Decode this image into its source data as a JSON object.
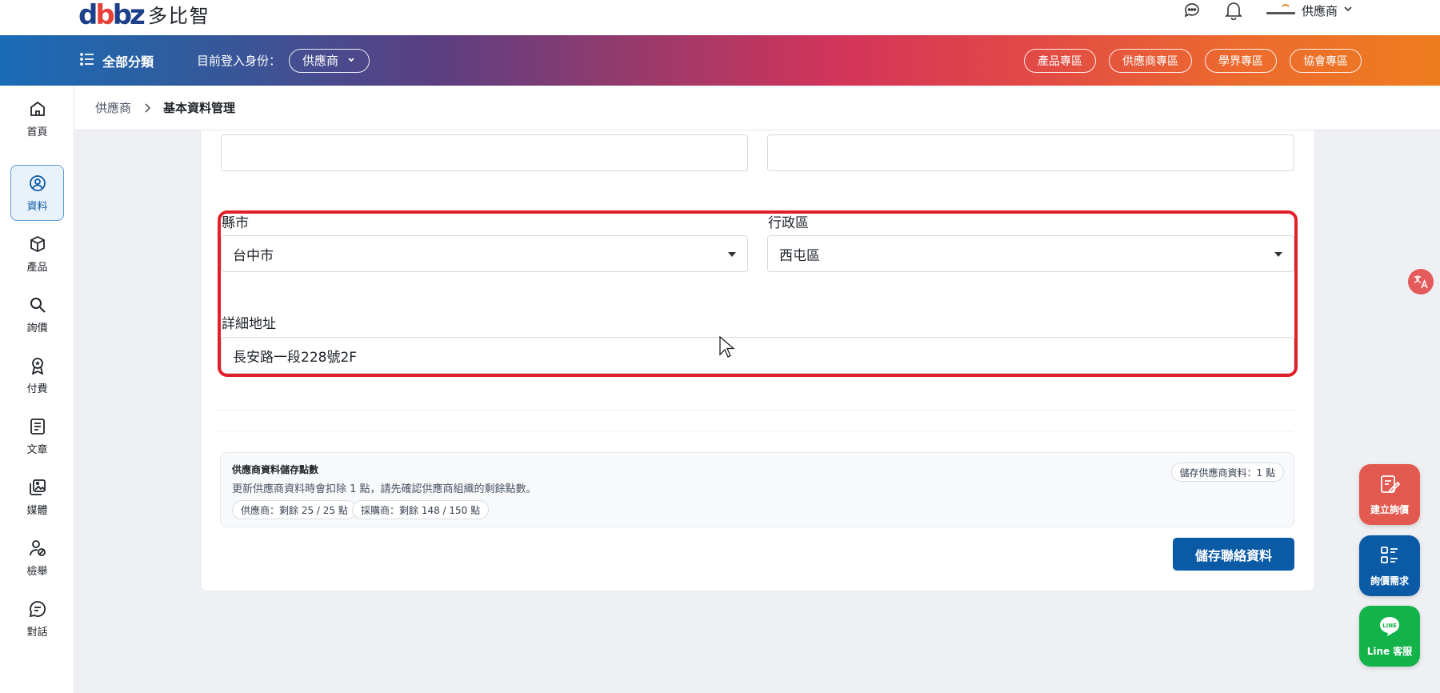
{
  "brand": {
    "name": "多比智",
    "mark": "dbbz"
  },
  "header": {
    "username": "供應商"
  },
  "nav": {
    "all_categories": "全部分類",
    "identity_label": "目前登入身份：",
    "identity_value": "供應商",
    "zones": [
      "產品專區",
      "供應商專區",
      "學界專區",
      "協會專區"
    ]
  },
  "sidebar": {
    "items": [
      {
        "label": "首頁",
        "icon": "home-icon"
      },
      {
        "label": "資料",
        "icon": "user-circle-icon"
      },
      {
        "label": "產品",
        "icon": "box-icon"
      },
      {
        "label": "詢價",
        "icon": "search-icon"
      },
      {
        "label": "付費",
        "icon": "award-icon"
      },
      {
        "label": "文章",
        "icon": "document-icon"
      },
      {
        "label": "媒體",
        "icon": "gallery-icon"
      },
      {
        "label": "檢舉",
        "icon": "user-ban-icon"
      },
      {
        "label": "對話",
        "icon": "chat-icon"
      }
    ],
    "active_index": 1
  },
  "breadcrumb": {
    "parent": "供應商",
    "current": "基本資料管理"
  },
  "form": {
    "city_label": "縣市",
    "city_value": "台中市",
    "district_label": "行政區",
    "district_value": "西屯區",
    "address_label": "詳細地址",
    "address_value": "長安路一段228號2F"
  },
  "points": {
    "title": "供應商資料儲存點數",
    "description": "更新供應商資料時會扣除 1 點，請先確認供應商組織的剩餘點數。",
    "cost_badge": "儲存供應商資料：1 點",
    "supplier_pill": "供應商：剩餘 25 / 25 點",
    "buyer_pill": "採購商：剩餘 148 / 150 點"
  },
  "actions": {
    "save_label": "儲存聯絡資料"
  },
  "floating": {
    "create_inquiry": "建立詢價",
    "inquiry_needs": "詢價需求",
    "line_service": "Line 客服",
    "line_logo_text": "LINE"
  },
  "colors": {
    "accent_blue": "#0b5aa6",
    "highlight_red": "#e0202a",
    "create_btn": "#e25a4f",
    "needs_btn": "#0b5aa6",
    "line_btn": "#14b34a"
  }
}
